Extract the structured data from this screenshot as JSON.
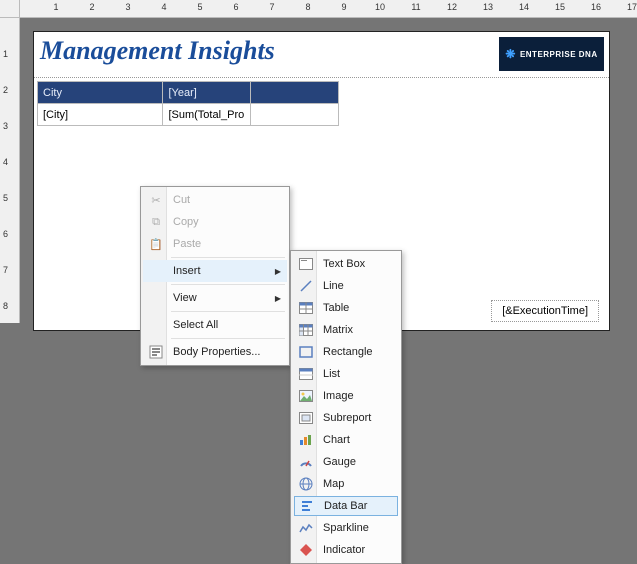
{
  "ruler": [
    "1",
    "2",
    "3",
    "4",
    "5",
    "6",
    "7",
    "8",
    "9",
    "10",
    "11",
    "12",
    "13",
    "14",
    "15",
    "16",
    "17"
  ],
  "vruler": [
    "1",
    "2",
    "3",
    "4",
    "5",
    "6",
    "7",
    "8"
  ],
  "report": {
    "title": "Management Insights",
    "logo_text": "ENTERPRISE DNA",
    "table": {
      "headers": [
        "City",
        "[Year]",
        ""
      ],
      "row": [
        "[City]",
        "[Sum(Total_Pro",
        ""
      ]
    },
    "footer": "[&ExecutionTime]"
  },
  "context_menu": {
    "cut": "Cut",
    "copy": "Copy",
    "paste": "Paste",
    "insert": "Insert",
    "view": "View",
    "select_all": "Select All",
    "body_props": "Body Properties..."
  },
  "insert_menu": {
    "text_box": "Text Box",
    "line": "Line",
    "table": "Table",
    "matrix": "Matrix",
    "rectangle": "Rectangle",
    "list": "List",
    "image": "Image",
    "subreport": "Subreport",
    "chart": "Chart",
    "gauge": "Gauge",
    "map": "Map",
    "data_bar": "Data Bar",
    "sparkline": "Sparkline",
    "indicator": "Indicator"
  }
}
